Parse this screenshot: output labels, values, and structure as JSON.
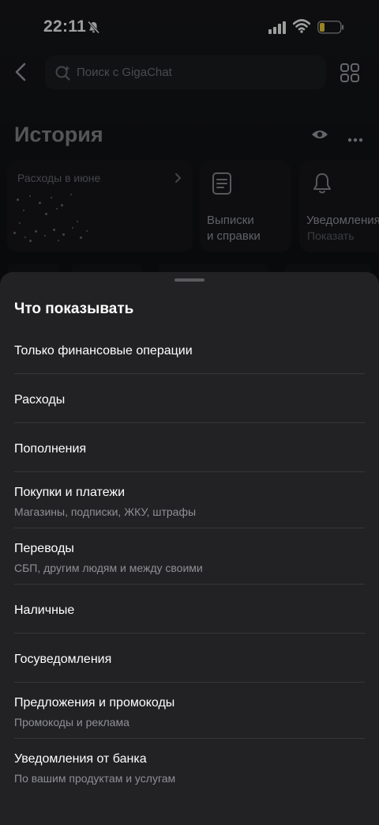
{
  "status_bar": {
    "time": "22:11",
    "battery_color": "#f5d33c"
  },
  "search": {
    "placeholder": "Поиск с GigaChat"
  },
  "history": {
    "title": "История"
  },
  "cards": [
    {
      "title": "Расходы в июне"
    },
    {
      "title_line1": "Выписки",
      "title_line2": "и справки"
    },
    {
      "title": "Уведомления",
      "subtitle": "Показать"
    }
  ],
  "sheet": {
    "title": "Что показывать",
    "options": [
      {
        "label": "Только финансовые операции"
      },
      {
        "label": "Расходы"
      },
      {
        "label": "Пополнения"
      },
      {
        "label": "Покупки и платежи",
        "subtitle": "Магазины, подписки, ЖКУ, штрафы"
      },
      {
        "label": "Переводы",
        "subtitle": "СБП, другим людям и между своими"
      },
      {
        "label": "Наличные"
      },
      {
        "label": "Госуведомления"
      },
      {
        "label": "Предложения и промокоды",
        "subtitle": "Промокоды и реклама"
      },
      {
        "label": "Уведомления от банка",
        "subtitle": "По вашим продуктам и услугам"
      }
    ]
  }
}
